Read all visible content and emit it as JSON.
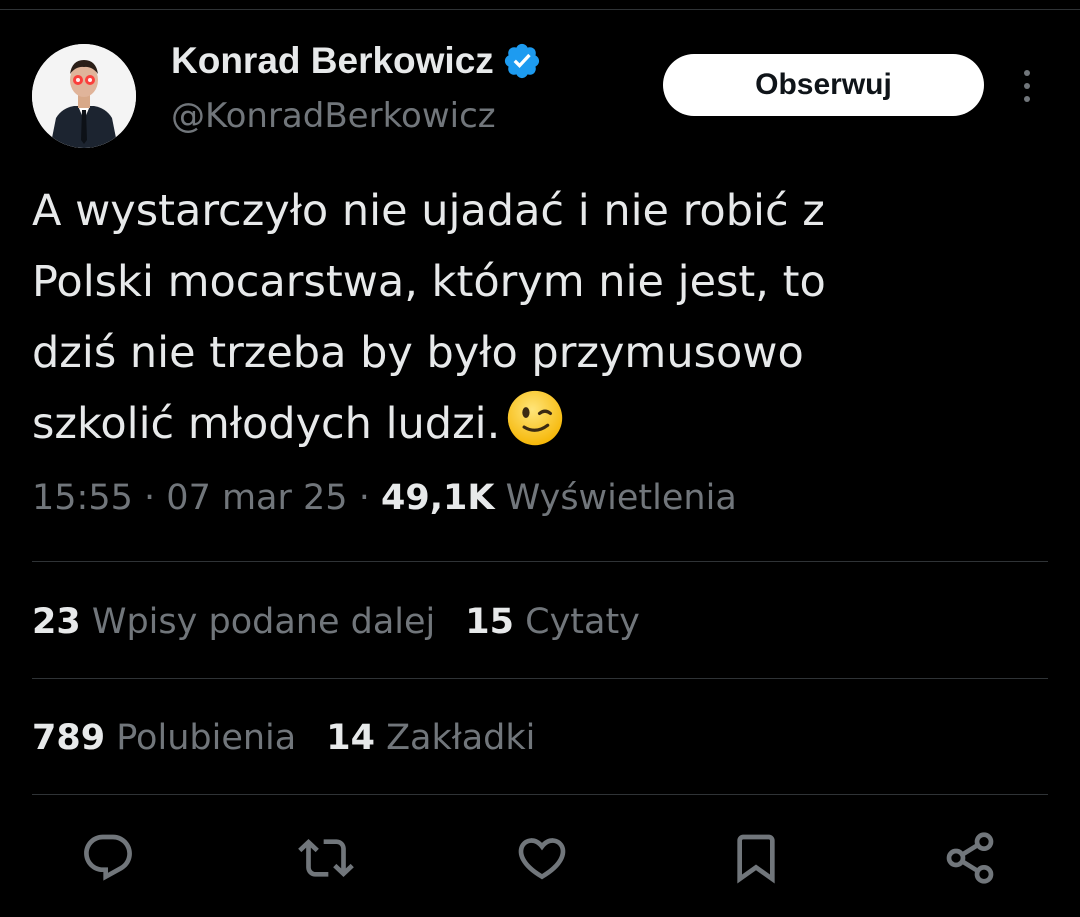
{
  "author": {
    "name": "Konrad Berkowicz",
    "handle": "@KonradBerkowicz"
  },
  "follow_button": "Obserwuj",
  "tweet": {
    "lines": [
      "A wystarczyło nie ujadać i nie robić z",
      "Polski mocarstwa, którym nie jest, to",
      "dziś nie trzeba by było przymusowo",
      "szkolić młodych ludzi."
    ]
  },
  "meta": {
    "time": "15:55",
    "separator": "·",
    "date": "07 mar 25",
    "views_count": "49,1K",
    "views_label": "Wyświetlenia"
  },
  "stats": {
    "reposts_count": "23",
    "reposts_label": "Wpisy podane dalej",
    "quotes_count": "15",
    "quotes_label": "Cytaty",
    "likes_count": "789",
    "likes_label": "Polubienia",
    "bookmarks_count": "14",
    "bookmarks_label": "Zakładki"
  },
  "icons": {
    "verified": "verified-badge-icon",
    "more": "more-vertical-icon",
    "reply": "reply-icon",
    "repost": "repost-icon",
    "like": "heart-icon",
    "bookmark": "bookmark-icon",
    "share": "share-icon"
  },
  "colors": {
    "background": "#000000",
    "text_primary": "#e7e9ea",
    "text_secondary": "#71767b",
    "divider": "#2f3336",
    "verified_blue": "#1d9bf0",
    "button_bg": "#ffffff"
  }
}
